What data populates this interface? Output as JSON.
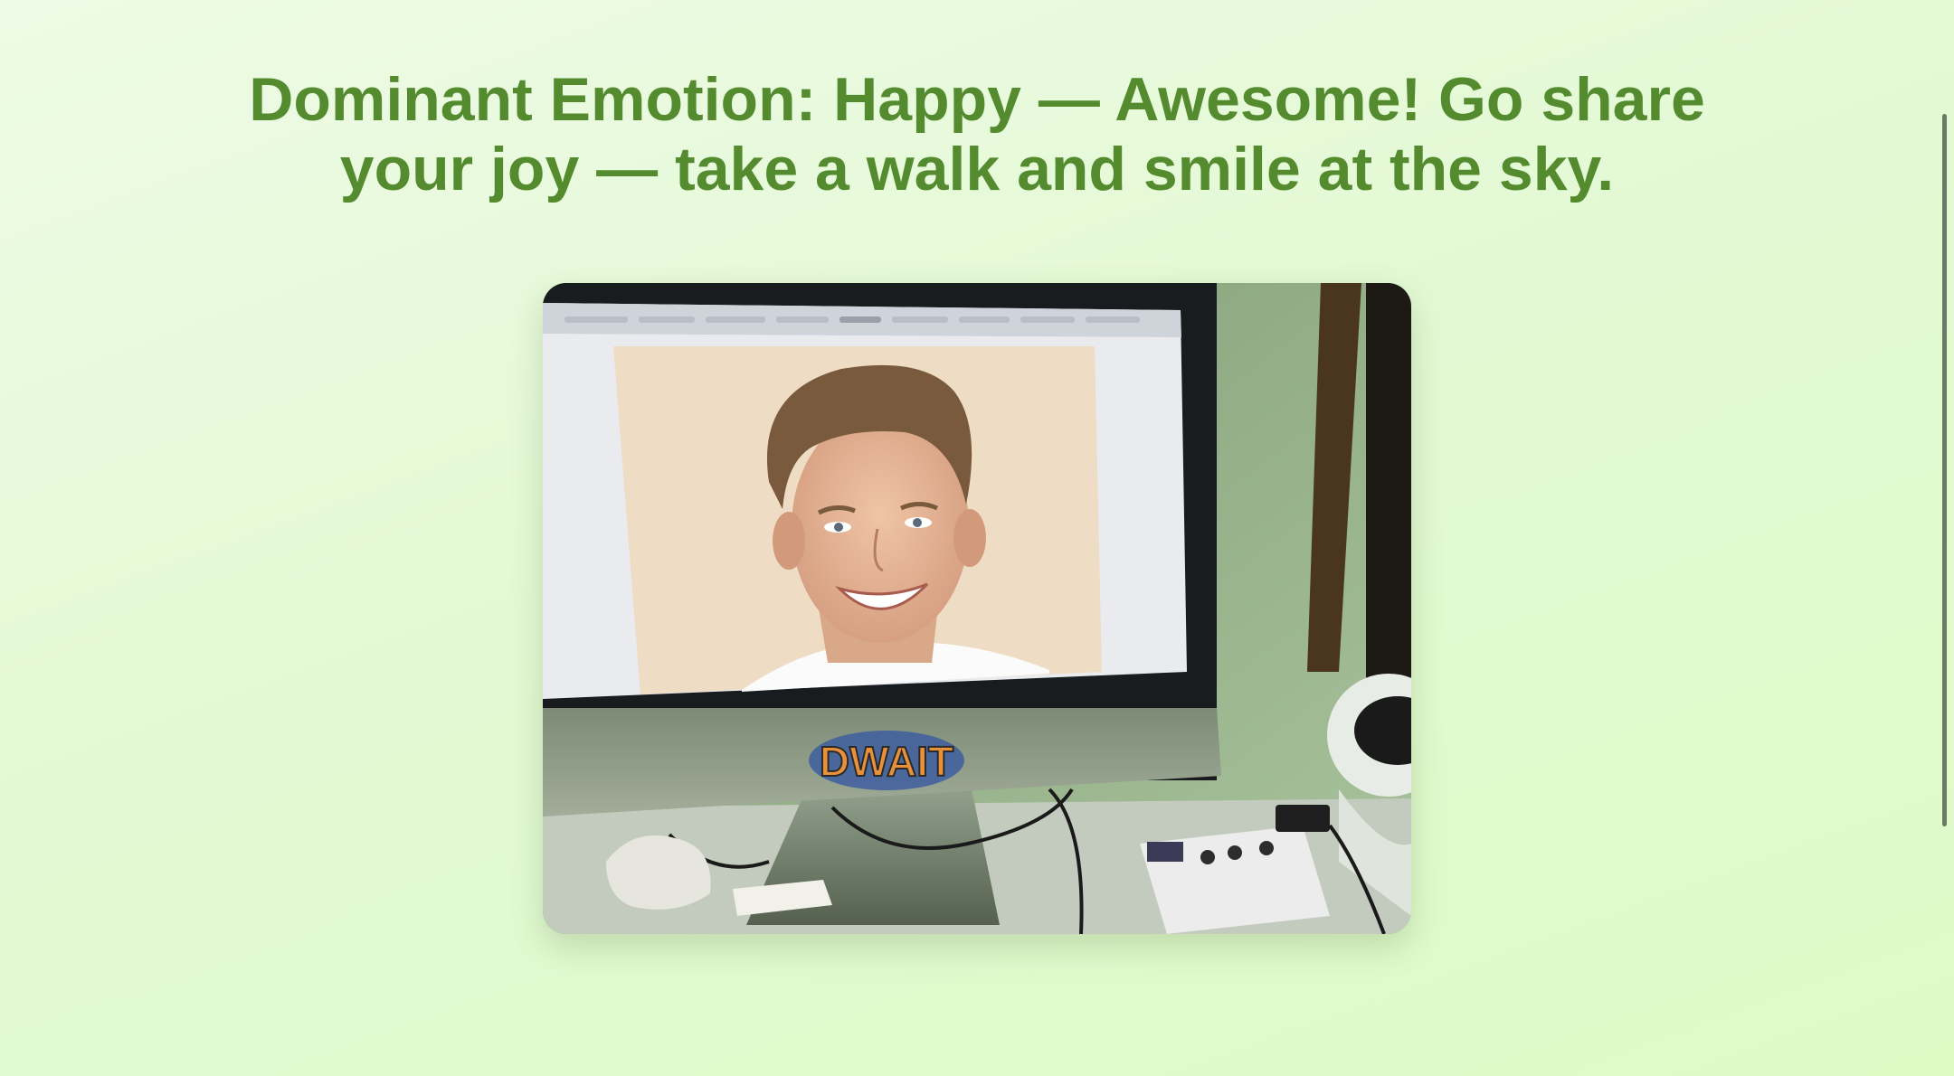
{
  "result": {
    "headline": "Dominant Emotion: Happy — Awesome! Go share your joy — take a walk and smile at the sky."
  },
  "photo": {
    "sticker_text": "DWAIT"
  },
  "colors": {
    "headline": "#558b2f",
    "background_start": "#eefbe6",
    "background_end": "#defbc6"
  }
}
